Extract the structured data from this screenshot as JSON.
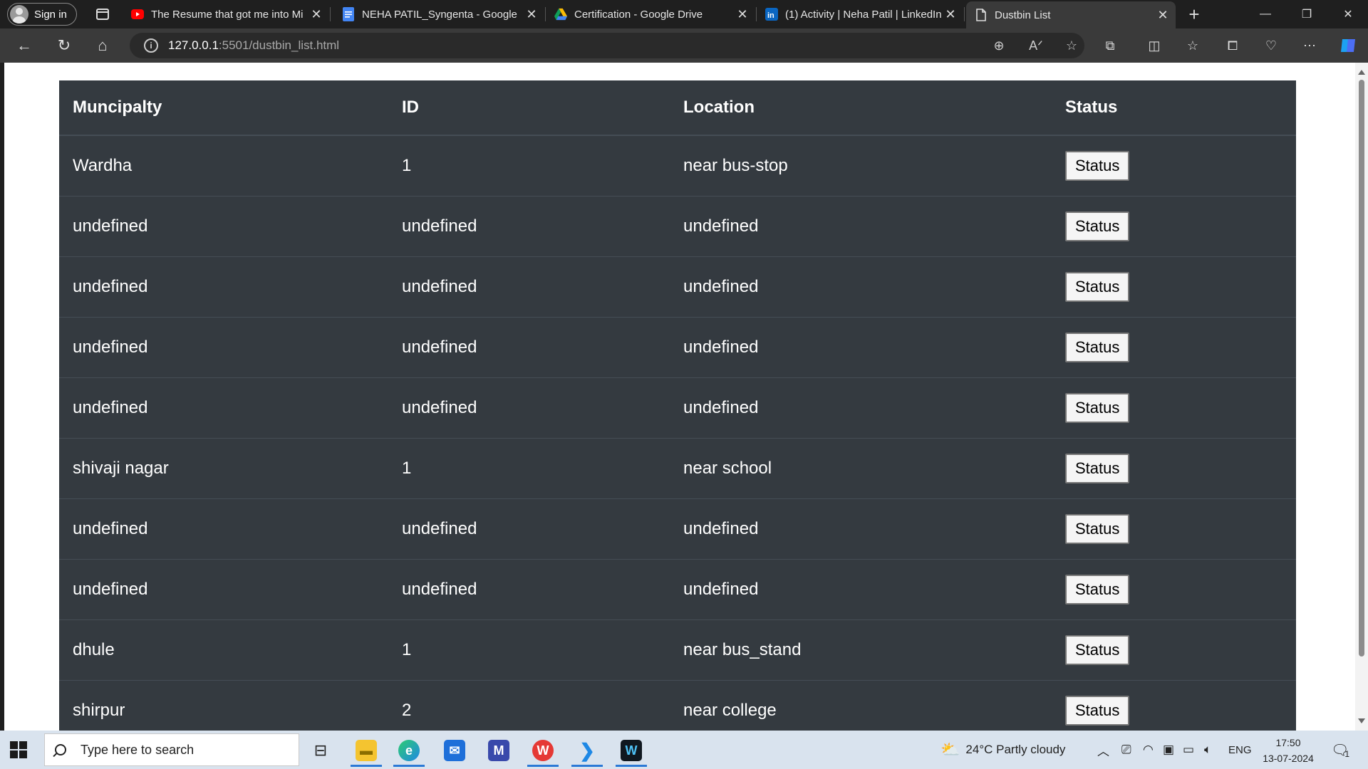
{
  "browser": {
    "signin_label": "Sign in",
    "tabs": [
      {
        "title": "The Resume that got me into Mi",
        "icon": "youtube-icon"
      },
      {
        "title": "NEHA PATIL_Syngenta - Google",
        "icon": "google-docs-icon"
      },
      {
        "title": "Certification - Google Drive",
        "icon": "google-drive-icon"
      },
      {
        "title": "(1) Activity | Neha Patil | LinkedIn",
        "icon": "linkedin-icon"
      },
      {
        "title": "Dustbin List",
        "icon": "page-icon",
        "active": true
      }
    ],
    "url_host": "127.0.0.1",
    "url_rest": ":5501/dustbin_list.html"
  },
  "table": {
    "headers": [
      "Muncipalty",
      "ID",
      "Location",
      "Status"
    ],
    "button_label": "Status",
    "rows": [
      {
        "municipality": "Wardha",
        "id": "1",
        "location": "near bus-stop"
      },
      {
        "municipality": "undefined",
        "id": "undefined",
        "location": "undefined"
      },
      {
        "municipality": "undefined",
        "id": "undefined",
        "location": "undefined"
      },
      {
        "municipality": "undefined",
        "id": "undefined",
        "location": "undefined"
      },
      {
        "municipality": "undefined",
        "id": "undefined",
        "location": "undefined"
      },
      {
        "municipality": "shivaji nagar",
        "id": "1",
        "location": "near school"
      },
      {
        "municipality": "undefined",
        "id": "undefined",
        "location": "undefined"
      },
      {
        "municipality": "undefined",
        "id": "undefined",
        "location": "undefined"
      },
      {
        "municipality": "dhule",
        "id": "1",
        "location": "near bus_stand"
      },
      {
        "municipality": "shirpur",
        "id": "2",
        "location": "near college"
      }
    ]
  },
  "taskbar": {
    "search_placeholder": "Type here to search",
    "weather": "24°C  Partly cloudy",
    "language": "ENG",
    "time": "17:50",
    "date": "13-07-2024",
    "notification_count": "1"
  },
  "colors": {
    "table_bg": "#343a40",
    "table_border": "#454d55",
    "taskbar_bg": "#d9e3ee",
    "browser_chrome": "#1f1f1f"
  }
}
